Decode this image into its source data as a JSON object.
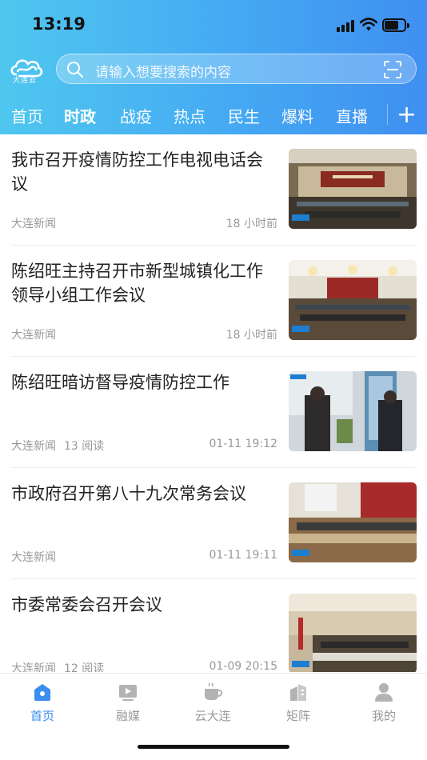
{
  "status": {
    "time": "13:19"
  },
  "logo": {
    "text": "大连云"
  },
  "search": {
    "placeholder": "请输入想要搜索的内容"
  },
  "tabs": [
    {
      "label": "首页"
    },
    {
      "label": "时政"
    },
    {
      "label": "战疫"
    },
    {
      "label": "热点"
    },
    {
      "label": "民生"
    },
    {
      "label": "爆料"
    },
    {
      "label": "直播"
    }
  ],
  "active_tab": "时政",
  "plus_label": "+",
  "news": [
    {
      "title": "我市召开疫情防控工作电视电话会议",
      "source": "大连新闻",
      "reads": "",
      "time": "18 小时前"
    },
    {
      "title": "陈绍旺主持召开市新型城镇化工作领导小组工作会议",
      "source": "大连新闻",
      "reads": "",
      "time": "18 小时前"
    },
    {
      "title": "陈绍旺暗访督导疫情防控工作",
      "source": "大连新闻",
      "reads": "13 阅读",
      "time": "01-11 19:12"
    },
    {
      "title": "市政府召开第八十九次常务会议",
      "source": "大连新闻",
      "reads": "",
      "time": "01-11 19:11"
    },
    {
      "title": "市委常委会召开会议",
      "source": "大连新闻",
      "reads": "12 阅读",
      "time": "01-09 20:15"
    }
  ],
  "tabbar": [
    {
      "label": "首页",
      "icon": "home-icon",
      "active": true
    },
    {
      "label": "融媒",
      "icon": "video-icon",
      "active": false
    },
    {
      "label": "云大连",
      "icon": "cup-icon",
      "active": false
    },
    {
      "label": "矩阵",
      "icon": "buildings-icon",
      "active": false
    },
    {
      "label": "我的",
      "icon": "user-icon",
      "active": false
    }
  ],
  "colors": {
    "accent": "#3b8ef0",
    "header_start": "#4fc7ef",
    "header_end": "#3f8ff0"
  }
}
